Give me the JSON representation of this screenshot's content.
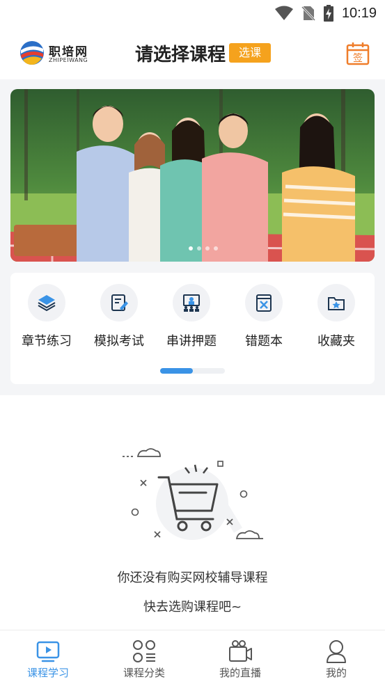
{
  "status_bar": {
    "time": "10:19"
  },
  "header": {
    "logo_text": "职培网",
    "logo_sub": "ZHIPEIWANG",
    "title": "请选择课程",
    "select_badge": "选课",
    "signin_icon_char": "签"
  },
  "banner": {
    "slide_count": 4,
    "active_slide": 1
  },
  "features": [
    {
      "label": "章节练习",
      "icon": "layers-icon"
    },
    {
      "label": "模拟考试",
      "icon": "exam-paper-icon"
    },
    {
      "label": "串讲押题",
      "icon": "lecture-icon"
    },
    {
      "label": "错题本",
      "icon": "wrong-book-icon"
    },
    {
      "label": "收藏夹",
      "icon": "favorite-folder-icon"
    }
  ],
  "features_scroll_fraction": 0.5,
  "empty_state": {
    "line1": "你还没有购买网校辅导课程",
    "line2": "快去选购课程吧~"
  },
  "bottom_nav": [
    {
      "label": "课程学习",
      "icon": "video-play-icon",
      "active": true
    },
    {
      "label": "课程分类",
      "icon": "category-icon",
      "active": false
    },
    {
      "label": "我的直播",
      "icon": "live-camera-icon",
      "active": false
    },
    {
      "label": "我的",
      "icon": "user-icon",
      "active": false
    }
  ],
  "colors": {
    "accent_blue": "#3a93e6",
    "badge_orange": "#f5a21d",
    "signin_orange": "#ef7d2a"
  }
}
